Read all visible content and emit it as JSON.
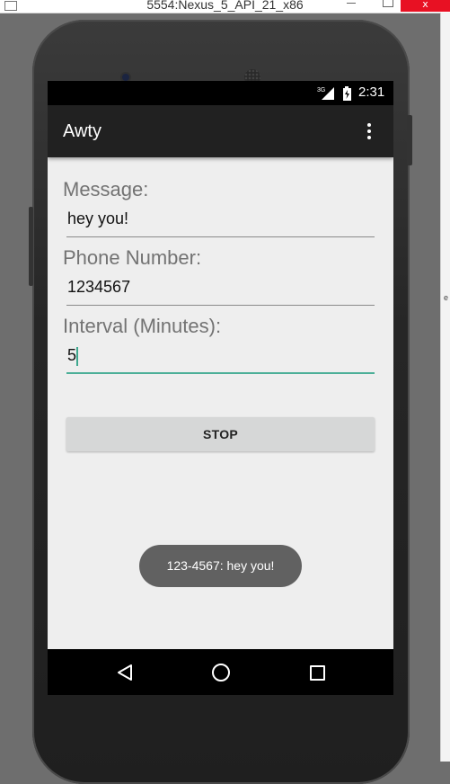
{
  "window": {
    "title": "5554:Nexus_5_API_21_x86",
    "close_glyph": "x"
  },
  "side_strip_mark": "e",
  "status_bar": {
    "network": "3G",
    "time": "2:31"
  },
  "app_bar": {
    "title": "Awty",
    "overflow_icon": "more-vert-icon"
  },
  "form": {
    "message_label": "Message:",
    "message_value": "hey you!",
    "phone_label": "Phone Number:",
    "phone_value": "1234567",
    "interval_label": "Interval (Minutes):",
    "interval_value": "5"
  },
  "stop_button": {
    "label": "STOP"
  },
  "toast": {
    "text": "123-4567: hey you!"
  },
  "nav_bar": {
    "back_icon": "back-icon",
    "home_icon": "home-icon",
    "recents_icon": "recents-icon"
  },
  "colors": {
    "accent": "#4caf98",
    "app_bar": "#212121",
    "screen_bg": "#eeeeee",
    "toast_bg": "#616161"
  }
}
